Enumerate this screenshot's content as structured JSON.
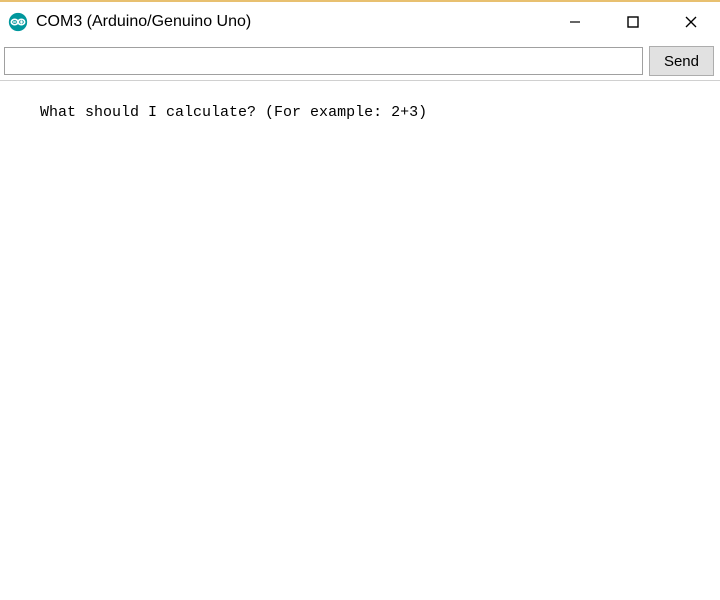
{
  "window": {
    "title": "COM3 (Arduino/Genuino Uno)",
    "icon_color_outer": "#00979D",
    "icon_color_inner": "#ffffff"
  },
  "toolbar": {
    "input_value": "",
    "send_label": "Send"
  },
  "output": {
    "lines": [
      "What should I calculate? (For example: 2+3)"
    ]
  }
}
